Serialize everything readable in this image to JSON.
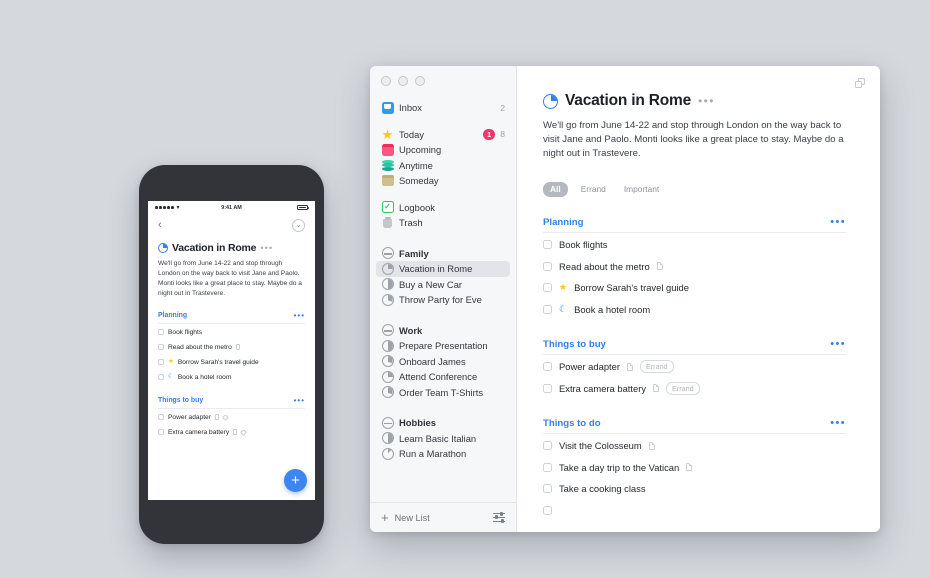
{
  "window": {
    "copy_icon": "duplicate-window-icon",
    "traffic_lights": [
      "close",
      "minimize",
      "maximize"
    ]
  },
  "sidebar": {
    "groups": [
      {
        "items": [
          {
            "label": "Inbox",
            "icon": "inbox-icon",
            "count": "2"
          }
        ]
      },
      {
        "items": [
          {
            "label": "Today",
            "icon": "star-icon",
            "badge": "1",
            "count": "8"
          },
          {
            "label": "Upcoming",
            "icon": "calendar-icon"
          },
          {
            "label": "Anytime",
            "icon": "layers-icon"
          },
          {
            "label": "Someday",
            "icon": "box-icon"
          }
        ]
      },
      {
        "items": [
          {
            "label": "Logbook",
            "icon": "logbook-icon"
          },
          {
            "label": "Trash",
            "icon": "trash-icon"
          }
        ]
      },
      {
        "items": [
          {
            "label": "Family",
            "icon": "area-icon",
            "header": true
          },
          {
            "label": "Vacation in Rome",
            "icon": "project-icon",
            "selected": true
          },
          {
            "label": "Buy a New Car",
            "icon": "project-icon"
          },
          {
            "label": "Throw Party for Eve",
            "icon": "project-icon"
          }
        ]
      },
      {
        "items": [
          {
            "label": "Work",
            "icon": "area-icon",
            "header": true
          },
          {
            "label": "Prepare Presentation",
            "icon": "project-icon"
          },
          {
            "label": "Onboard James",
            "icon": "project-icon"
          },
          {
            "label": "Attend Conference",
            "icon": "project-icon"
          },
          {
            "label": "Order Team T-Shirts",
            "icon": "project-icon"
          }
        ]
      },
      {
        "items": [
          {
            "label": "Hobbies",
            "icon": "area-icon",
            "header": true
          },
          {
            "label": "Learn Basic Italian",
            "icon": "project-icon"
          },
          {
            "label": "Run a Marathon",
            "icon": "project-icon"
          }
        ]
      }
    ],
    "footer": {
      "new_list_label": "New List",
      "plus": "+",
      "filter_icon": "filter-icon"
    }
  },
  "project": {
    "title": "Vacation in Rome",
    "dots": "•••",
    "note": "We'll go from June 14-22 and stop through London on the way back to visit Jane and Paolo. Monti looks like a great place to stay. Maybe do a night out in Trastevere.",
    "filters": [
      {
        "label": "All",
        "active": true
      },
      {
        "label": "Errand",
        "active": false
      },
      {
        "label": "Important",
        "active": false
      }
    ],
    "sections": [
      {
        "title": "Planning",
        "todos": [
          {
            "label": "Book flights"
          },
          {
            "label": "Read about the metro",
            "note": true
          },
          {
            "label": "Borrow Sarah's travel guide",
            "star": true
          },
          {
            "label": "Book a hotel room",
            "moon": true
          }
        ]
      },
      {
        "title": "Things to buy",
        "todos": [
          {
            "label": "Power adapter",
            "note": true,
            "tag": "Errand"
          },
          {
            "label": "Extra camera battery",
            "note": true,
            "tag": "Errand"
          }
        ]
      },
      {
        "title": "Things to do",
        "todos": [
          {
            "label": "Visit the Colosseum",
            "note": true
          },
          {
            "label": "Take a day trip to the Vatican",
            "note": true
          },
          {
            "label": "Take a cooking class"
          },
          {
            "label": ""
          }
        ]
      }
    ]
  },
  "phone": {
    "status": {
      "time": "9:41 AM",
      "wifi": "wifi-icon",
      "battery": "battery-icon"
    },
    "nav": {
      "back": "‹",
      "chevron": "⌄"
    },
    "title": "Vacation in Rome",
    "dots": "•••",
    "note": "We'll go from June 14-22 and stop through London on the way back to visit Jane and Paolo. Monti looks like a great place to stay. Maybe do a night out in Trastevere.",
    "sections": [
      {
        "title": "Planning",
        "todos": [
          {
            "label": "Book flights"
          },
          {
            "label": "Read about the metro",
            "note": true
          },
          {
            "label": "Borrow Sarah's travel guide",
            "star": true
          },
          {
            "label": "Book a hotel room",
            "moon": true
          }
        ]
      },
      {
        "title": "Things to buy",
        "todos": [
          {
            "label": "Power adapter",
            "note": true,
            "tagicon": true
          },
          {
            "label": "Extra camera battery",
            "note": true,
            "tagicon": true
          }
        ]
      }
    ],
    "fab": "+"
  },
  "colors": {
    "accent_blue": "#2f7ff0",
    "star_yellow": "#ffc518",
    "badge_pink": "#f4336d",
    "background": "#d5d8dd"
  }
}
